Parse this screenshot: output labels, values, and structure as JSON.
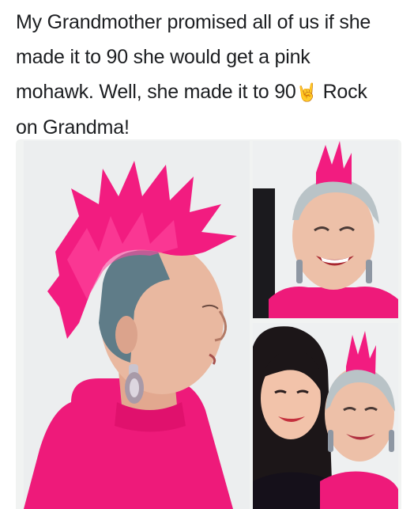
{
  "post": {
    "caption_line1": "My Grandmother promised all of us if she",
    "caption_line2": "made it to 90 she would get a pink",
    "caption_line3_before_emoji": "mohawk. Well, she made it to 90",
    "caption_emoji": "🤘",
    "caption_line3_after_emoji": " Rock",
    "caption_line4": "on Grandma!"
  },
  "colors": {
    "hot_pink": "#f0187a",
    "background_wall": "#eef1f0",
    "skin": "#e8b49c",
    "teal_hair": "#5d7a86"
  },
  "photos": [
    {
      "name": "profile-mohawk-photo"
    },
    {
      "name": "smiling-grandmother-photo"
    },
    {
      "name": "grandmother-with-granddaughter-photo"
    }
  ]
}
